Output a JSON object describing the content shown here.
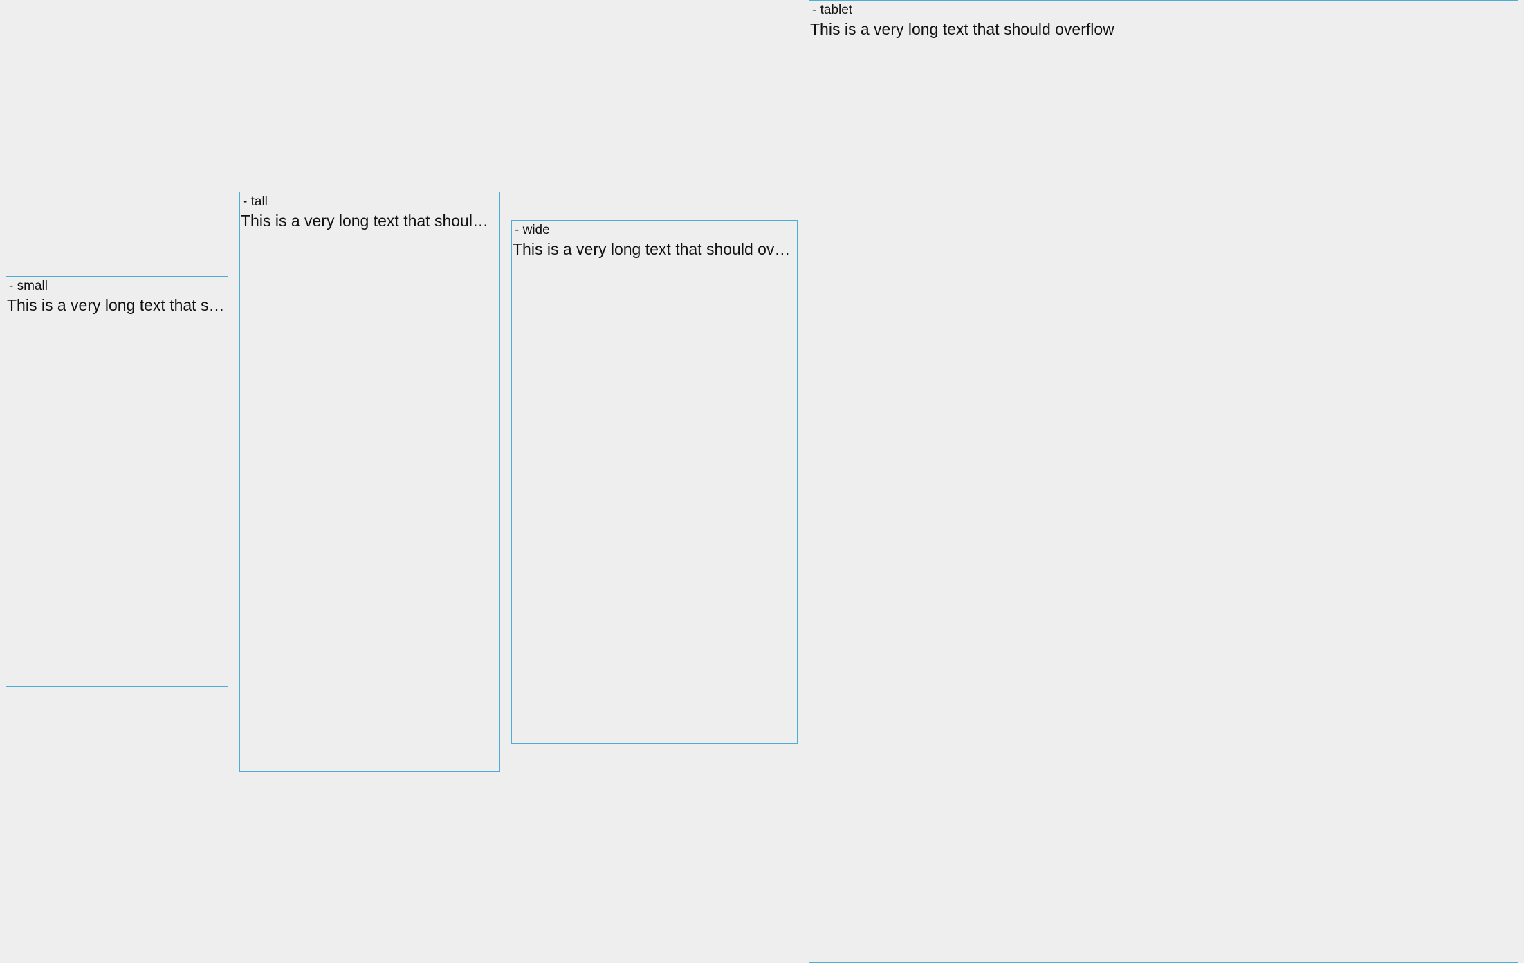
{
  "viewports": [
    {
      "id": "small",
      "label": "- small",
      "text": "This is a very long text that should overflow"
    },
    {
      "id": "tall",
      "label": "- tall",
      "text": "This is a very long text that should overflow"
    },
    {
      "id": "wide",
      "label": "- wide",
      "text": "This is a very long text that should overflow"
    },
    {
      "id": "tablet",
      "label": "- tablet",
      "text": "This is a very long text that should overflow"
    }
  ],
  "colors": {
    "background": "#eeeeee",
    "border": "#4aaed6",
    "text": "#111111"
  }
}
